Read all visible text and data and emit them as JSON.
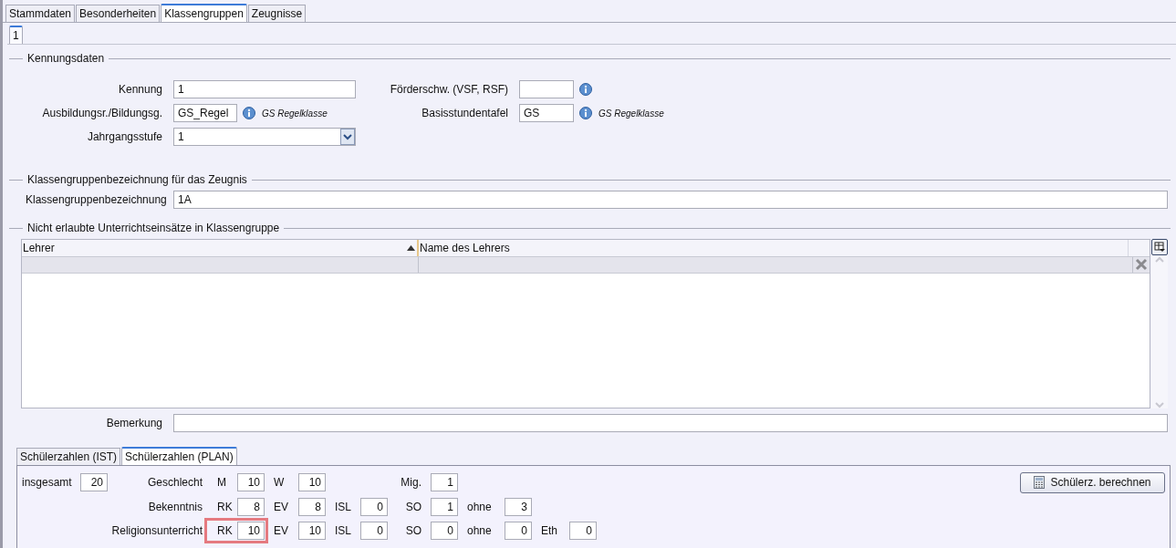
{
  "tabs": [
    {
      "label": "Stammdaten",
      "selected": false
    },
    {
      "label": "Besonderheiten",
      "selected": false
    },
    {
      "label": "Klassengruppen",
      "selected": true
    },
    {
      "label": "Zeugnisse",
      "selected": false
    }
  ],
  "subtabs": [
    {
      "label": "1",
      "selected": true
    }
  ],
  "kennungsdaten": {
    "title": "Kennungsdaten",
    "rows": [
      {
        "left": {
          "label": "Kennung",
          "kind": "text",
          "value": "1"
        },
        "right": {
          "label": "Förderschw. (VSF, RSF)",
          "kind": "lookup"
        }
      },
      {
        "left": {
          "label": "Ausbildungsr./Bildungsg.",
          "kind": "lookup",
          "value": "GS_Regel",
          "description": "GS Regelklasse"
        },
        "right": {
          "label": "Basisstundentafel",
          "kind": "lookup",
          "value": "GS",
          "description": "GS Regelklasse"
        }
      },
      {
        "left": {
          "label": "Jahrgangsstufe",
          "kind": "combo",
          "value": "1"
        }
      }
    ]
  },
  "bezeichnung": {
    "title": "Klassengruppenbezeichnung für das Zeugnis",
    "label": "Klassengruppenbezeichnung",
    "value": "1A"
  },
  "einsaetze": {
    "title": "Nicht erlaubte Unterrichtseinsätze in Klassengruppe",
    "columns": [
      {
        "label": "Lehrer",
        "sorted": true
      },
      {
        "label": "Name des Lehrers",
        "sorted": false
      }
    ],
    "remark_label": "Bemerkung"
  },
  "count_tabs": [
    {
      "label": "Schülerzahlen (IST)",
      "selected": false
    },
    {
      "label": "Schülerzahlen (PLAN)",
      "selected": true
    }
  ],
  "counts": {
    "total_label": "insgesamt",
    "total": "20",
    "button": "Schülerz. berechnen",
    "rows": [
      {
        "label": "Geschlecht",
        "pairs": [
          {
            "code": "M",
            "value": "10",
            "highlighted": false
          },
          {
            "code": "W",
            "value": "10",
            "highlighted": false
          }
        ],
        "extra": {
          "code": "Mig.",
          "value": "1"
        }
      },
      {
        "label": "Bekenntnis",
        "pairs": [
          {
            "code": "RK",
            "value": "8",
            "highlighted": false
          },
          {
            "code": "EV",
            "value": "8",
            "highlighted": false
          },
          {
            "code": "ISL",
            "value": "0",
            "highlighted": false
          },
          {
            "code": "SO",
            "value": "1",
            "highlighted": false
          },
          {
            "code": "ohne",
            "value": "3",
            "highlighted": false
          }
        ]
      },
      {
        "label": "Religionsunterricht",
        "pairs": [
          {
            "code": "RK",
            "value": "10",
            "highlighted": true
          },
          {
            "code": "EV",
            "value": "10",
            "highlighted": false
          },
          {
            "code": "ISL",
            "value": "0",
            "highlighted": false
          },
          {
            "code": "SO",
            "value": "0",
            "highlighted": false
          },
          {
            "code": "ohne",
            "value": "0",
            "highlighted": false
          },
          {
            "code": "Eth",
            "value": "0",
            "highlighted": false
          }
        ]
      }
    ]
  }
}
